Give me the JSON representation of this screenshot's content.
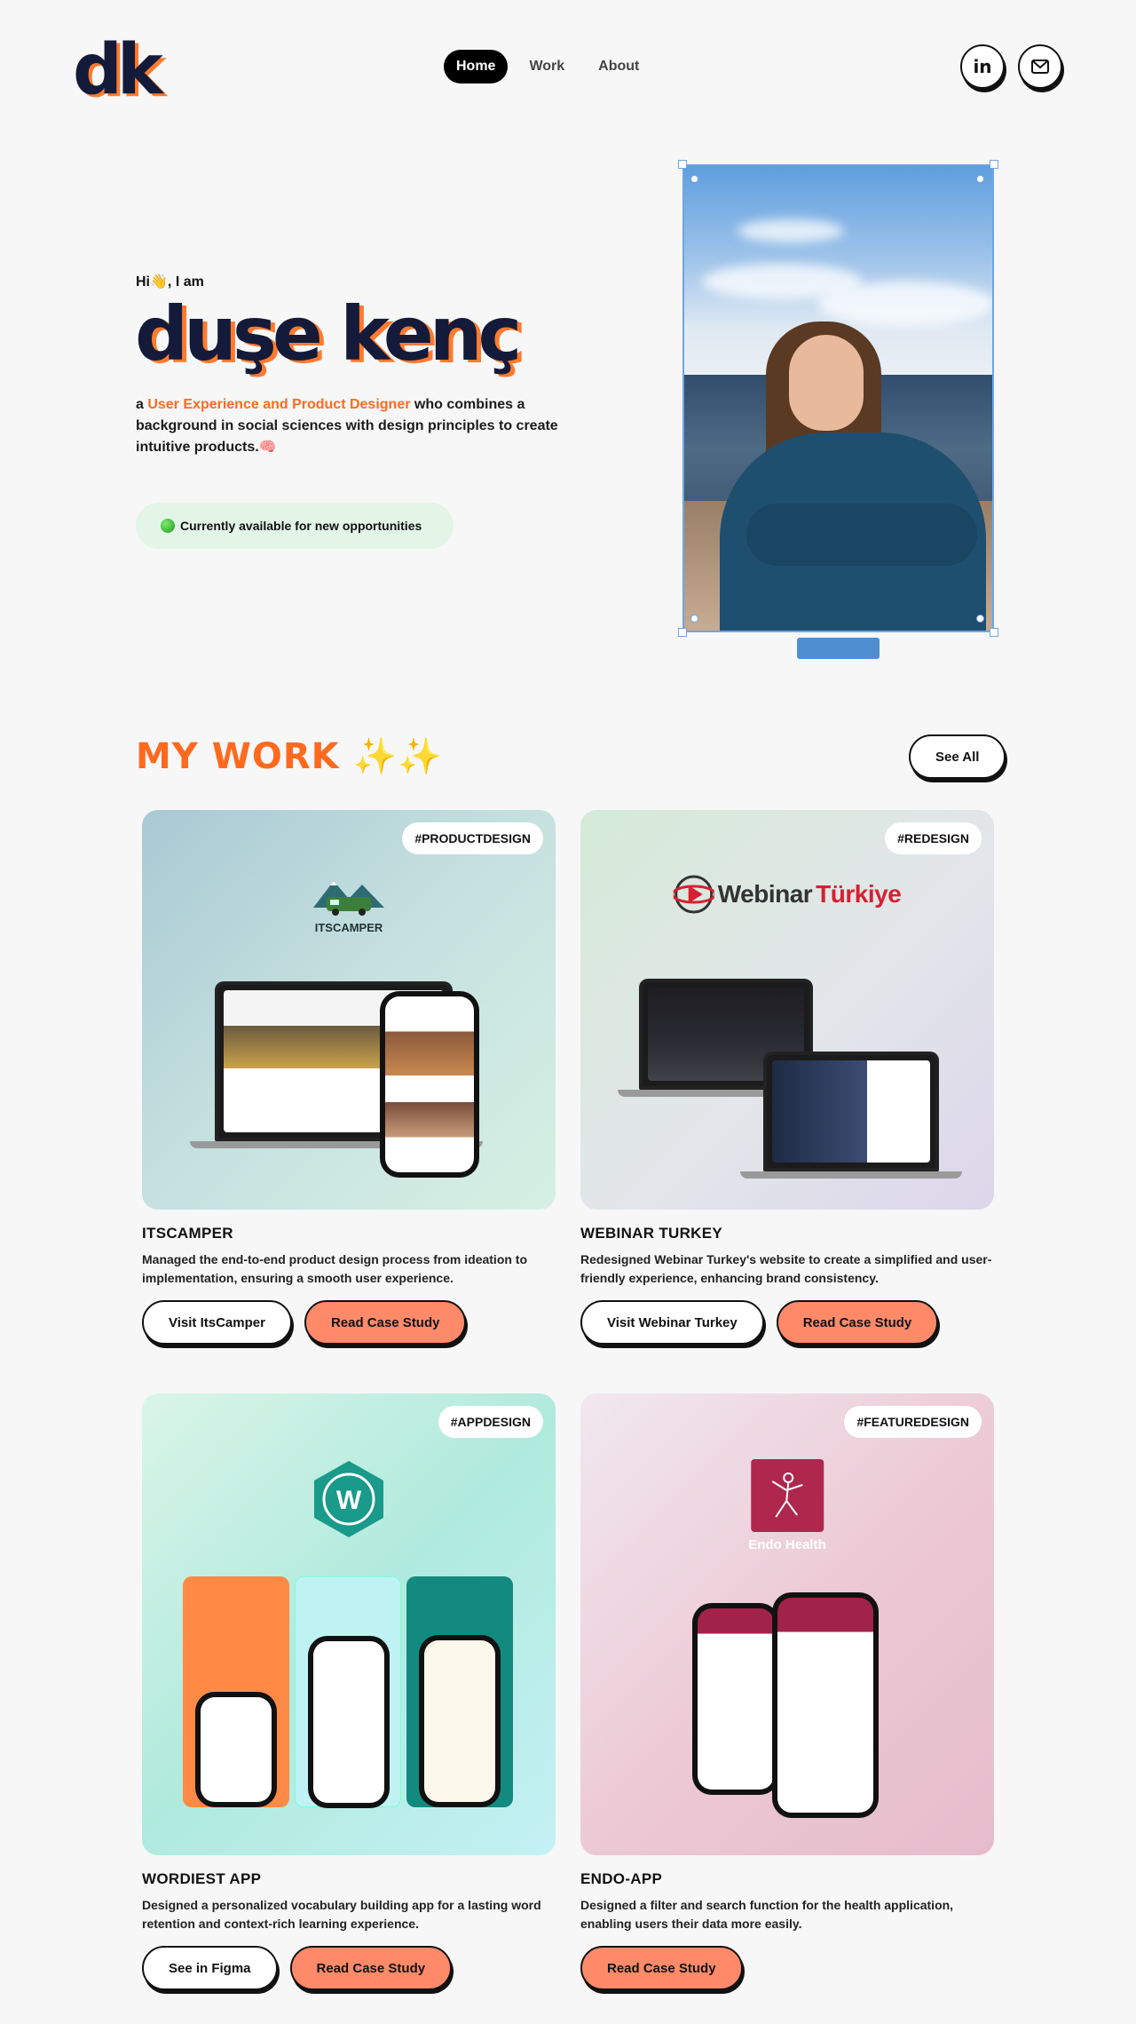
{
  "header": {
    "logo": "dk",
    "nav": [
      "Home",
      "Work",
      "About"
    ],
    "social_icons": [
      "linkedin-icon",
      "mail-icon"
    ]
  },
  "hero": {
    "greeting": "Hi👋, I am",
    "name": "duşe kenç",
    "bio_prefix": "a ",
    "bio_accent": "User Experience and Product Designer",
    "bio_suffix": " who combines a background in social sciences with design principles to create intuitive products.🧠",
    "availability": "Currently available for new opportunities"
  },
  "work": {
    "title": "MY WORK",
    "sparkles": "✨✨",
    "see_all": "See All",
    "projects": [
      {
        "tag": "#PRODUCTDESIGN",
        "brand": "ITSCAMPER",
        "title": "ITSCAMPER",
        "desc": "Managed the end-to-end product design process from ideation to implementation, ensuring a smooth user experience.",
        "primary": "Visit ItsCamper",
        "secondary": "Read Case Study"
      },
      {
        "tag": "#REDESIGN",
        "brand_a": "Webinar",
        "brand_b": "Türkiye",
        "title": "WEBINAR TURKEY",
        "desc": "Redesigned Webinar Turkey's website to create a simplified and user-friendly experience, enhancing brand consistency.",
        "primary": "Visit Webinar Turkey",
        "secondary": "Read Case Study"
      },
      {
        "tag": "#APPDESIGN",
        "brand": "W",
        "title": "WORDIEST APP",
        "desc": "Designed a personalized vocabulary building app for a lasting word retention and context-rich learning experience.",
        "primary": "See in Figma",
        "secondary": "Read Case Study"
      },
      {
        "tag": "#FEATUREDESIGN",
        "brand": "Endo Health",
        "title": "ENDO-APP",
        "desc": "Designed a filter and search function for the health application, enabling users their data more easily.",
        "secondary": "Read Case Study"
      }
    ]
  },
  "colors": {
    "accent": "#ff6a1f",
    "navy": "#141b3a",
    "button_orange": "#ff8a6a"
  }
}
